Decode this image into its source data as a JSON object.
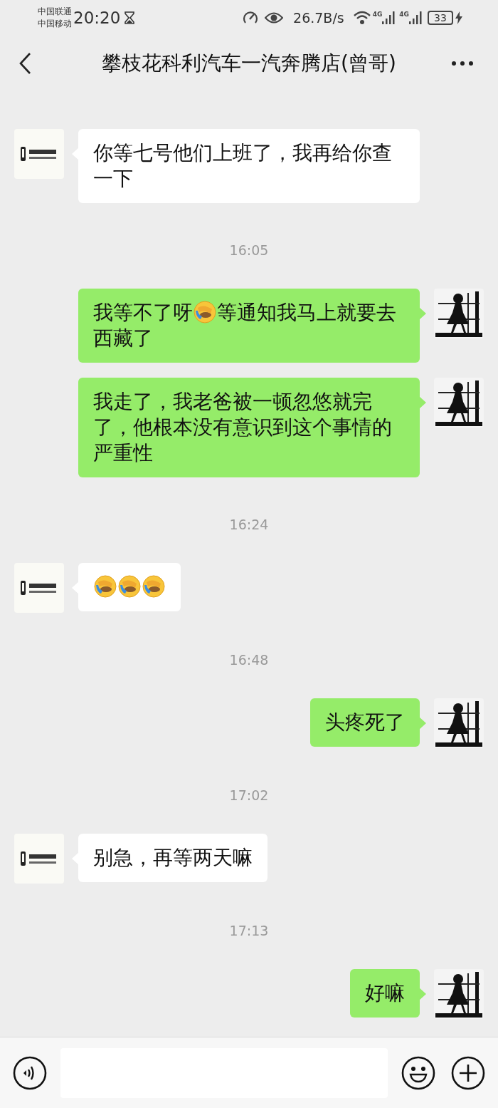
{
  "status_bar": {
    "carriers": [
      "中国联通",
      "中国移动"
    ],
    "time": "20:20",
    "network_speed": "26.7B/s",
    "signals": [
      "4G",
      "4G"
    ],
    "battery": "33"
  },
  "header": {
    "title": "攀枝花科利汽车一汽奔腾店(曾哥)"
  },
  "messages": [
    {
      "kind": "message",
      "outgoing": false,
      "parts": [
        {
          "kind": "text",
          "text": "你等七号他们上班了，我再给你查一下"
        }
      ]
    },
    {
      "kind": "time",
      "text": "16:05"
    },
    {
      "kind": "message",
      "outgoing": true,
      "parts": [
        {
          "kind": "text",
          "text": "我等不了呀"
        },
        {
          "kind": "emoji"
        },
        {
          "kind": "text",
          "text": "等通知我马上就要去西藏了"
        }
      ]
    },
    {
      "kind": "message",
      "outgoing": true,
      "parts": [
        {
          "kind": "text",
          "text": "我走了，我老爸被一顿忽悠就完了，他根本没有意识到这个事情的严重性"
        }
      ]
    },
    {
      "kind": "time",
      "text": "16:24"
    },
    {
      "kind": "message",
      "outgoing": false,
      "parts": [
        {
          "kind": "emoji"
        },
        {
          "kind": "emoji"
        },
        {
          "kind": "emoji"
        }
      ]
    },
    {
      "kind": "time",
      "text": "16:48"
    },
    {
      "kind": "message",
      "outgoing": true,
      "parts": [
        {
          "kind": "text",
          "text": "头疼死了"
        }
      ]
    },
    {
      "kind": "time",
      "text": "17:02"
    },
    {
      "kind": "message",
      "outgoing": false,
      "parts": [
        {
          "kind": "text",
          "text": "别急，再等两天嘛"
        }
      ]
    },
    {
      "kind": "time",
      "text": "17:13"
    },
    {
      "kind": "message",
      "outgoing": true,
      "parts": [
        {
          "kind": "text",
          "text": "好嘛"
        }
      ]
    }
  ]
}
